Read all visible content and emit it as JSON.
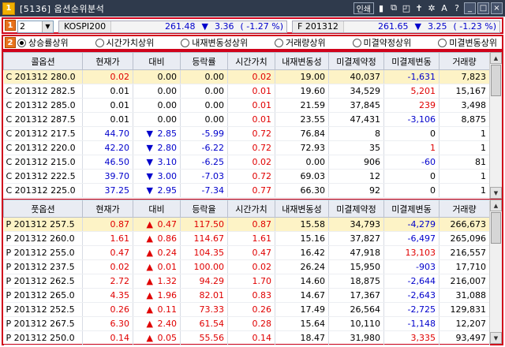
{
  "window": {
    "icon_label": "1",
    "title": "[5136] 옵션순위분석",
    "buttons": [
      "인쇄"
    ],
    "icons": [
      "pin-icon",
      "copy-icon",
      "window-icon",
      "pushpin-icon",
      "settings-icon",
      "font-icon",
      "help-icon",
      "minimize-icon",
      "maximize-icon",
      "close-icon"
    ],
    "icon_glyphs": [
      "▮",
      "⧉",
      "◰",
      "✝",
      "✲",
      "A",
      "?",
      "_",
      "□",
      "×"
    ]
  },
  "markers": [
    "1",
    "2"
  ],
  "controls": {
    "count_select": "2",
    "kospi": {
      "name": "KOSPI200",
      "value": "261.48",
      "direction": "▼",
      "diff": "3.36",
      "pct": "-1.27 %"
    },
    "future": {
      "name": "F 201312",
      "value": "261.65",
      "direction": "▼",
      "diff": "3.25",
      "pct": "-1.23 %"
    }
  },
  "radios": [
    {
      "label": "상승률상위",
      "selected": true
    },
    {
      "label": "시간가치상위",
      "selected": false
    },
    {
      "label": "내재변동성상위",
      "selected": false
    },
    {
      "label": "거래량상위",
      "selected": false
    },
    {
      "label": "미결약정상위",
      "selected": false
    },
    {
      "label": "미결변동상위",
      "selected": false
    }
  ],
  "call_table": {
    "headers": [
      "콜옵션",
      "현재가",
      "대비",
      "등락률",
      "시간가치",
      "내재변동성",
      "미결제약정",
      "미결제변동",
      "거래량"
    ],
    "rows": [
      {
        "code": "C 201312 280.0",
        "price": "0.02",
        "pc": "red",
        "dir": "",
        "diff": "0.00",
        "dc": "black",
        "rate": "0.00",
        "rc": "black",
        "tv": "0.02",
        "iv": "19.00",
        "oi": "40,037",
        "oic": "-1,631",
        "oicc": "blue",
        "vol": "7,823",
        "hl": true
      },
      {
        "code": "C 201312 282.5",
        "price": "0.01",
        "pc": "black",
        "dir": "",
        "diff": "0.00",
        "dc": "black",
        "rate": "0.00",
        "rc": "black",
        "tv": "0.01",
        "iv": "19.60",
        "oi": "34,529",
        "oic": "5,201",
        "oicc": "red",
        "vol": "15,167",
        "hl": false
      },
      {
        "code": "C 201312 285.0",
        "price": "0.01",
        "pc": "black",
        "dir": "",
        "diff": "0.00",
        "dc": "black",
        "rate": "0.00",
        "rc": "black",
        "tv": "0.01",
        "iv": "21.59",
        "oi": "37,845",
        "oic": "239",
        "oicc": "red",
        "vol": "3,498",
        "hl": false
      },
      {
        "code": "C 201312 287.5",
        "price": "0.01",
        "pc": "black",
        "dir": "",
        "diff": "0.00",
        "dc": "black",
        "rate": "0.00",
        "rc": "black",
        "tv": "0.01",
        "iv": "23.55",
        "oi": "47,431",
        "oic": "-3,106",
        "oicc": "blue",
        "vol": "8,875",
        "hl": false
      },
      {
        "code": "C 201312 217.5",
        "price": "44.70",
        "pc": "blue",
        "dir": "▼",
        "diff": "2.85",
        "dc": "blue",
        "rate": "-5.99",
        "rc": "blue",
        "tv": "0.72",
        "iv": "76.84",
        "oi": "8",
        "oic": "0",
        "oicc": "black",
        "vol": "1",
        "hl": false
      },
      {
        "code": "C 201312 220.0",
        "price": "42.20",
        "pc": "blue",
        "dir": "▼",
        "diff": "2.80",
        "dc": "blue",
        "rate": "-6.22",
        "rc": "blue",
        "tv": "0.72",
        "iv": "72.93",
        "oi": "35",
        "oic": "1",
        "oicc": "red",
        "vol": "1",
        "hl": false
      },
      {
        "code": "C 201312 215.0",
        "price": "46.50",
        "pc": "blue",
        "dir": "▼",
        "diff": "3.10",
        "dc": "blue",
        "rate": "-6.25",
        "rc": "blue",
        "tv": "0.02",
        "iv": "0.00",
        "oi": "906",
        "oic": "-60",
        "oicc": "blue",
        "vol": "81",
        "hl": false
      },
      {
        "code": "C 201312 222.5",
        "price": "39.70",
        "pc": "blue",
        "dir": "▼",
        "diff": "3.00",
        "dc": "blue",
        "rate": "-7.03",
        "rc": "blue",
        "tv": "0.72",
        "iv": "69.03",
        "oi": "12",
        "oic": "0",
        "oicc": "black",
        "vol": "1",
        "hl": false
      },
      {
        "code": "C 201312 225.0",
        "price": "37.25",
        "pc": "blue",
        "dir": "▼",
        "diff": "2.95",
        "dc": "blue",
        "rate": "-7.34",
        "rc": "blue",
        "tv": "0.77",
        "iv": "66.30",
        "oi": "92",
        "oic": "0",
        "oicc": "black",
        "vol": "1",
        "hl": false
      }
    ]
  },
  "put_table": {
    "headers": [
      "풋옵션",
      "현재가",
      "대비",
      "등락율",
      "시간가치",
      "내재변동성",
      "미결제약정",
      "미결제변동",
      "거래량"
    ],
    "rows": [
      {
        "code": "P 201312 257.5",
        "price": "0.87",
        "pc": "red",
        "dir": "▲",
        "diff": "0.47",
        "dc": "red",
        "rate": "117.50",
        "rc": "red",
        "tv": "0.87",
        "iv": "15.58",
        "oi": "34,793",
        "oic": "-4,279",
        "oicc": "blue",
        "vol": "266,673",
        "hl": true
      },
      {
        "code": "P 201312 260.0",
        "price": "1.61",
        "pc": "red",
        "dir": "▲",
        "diff": "0.86",
        "dc": "red",
        "rate": "114.67",
        "rc": "red",
        "tv": "1.61",
        "iv": "15.16",
        "oi": "37,827",
        "oic": "-6,497",
        "oicc": "blue",
        "vol": "265,096",
        "hl": false
      },
      {
        "code": "P 201312 255.0",
        "price": "0.47",
        "pc": "red",
        "dir": "▲",
        "diff": "0.24",
        "dc": "red",
        "rate": "104.35",
        "rc": "red",
        "tv": "0.47",
        "iv": "16.42",
        "oi": "47,918",
        "oic": "13,103",
        "oicc": "red",
        "vol": "216,557",
        "hl": false
      },
      {
        "code": "P 201312 237.5",
        "price": "0.02",
        "pc": "red",
        "dir": "▲",
        "diff": "0.01",
        "dc": "red",
        "rate": "100.00",
        "rc": "red",
        "tv": "0.02",
        "iv": "26.24",
        "oi": "15,950",
        "oic": "-903",
        "oicc": "blue",
        "vol": "17,710",
        "hl": false
      },
      {
        "code": "P 201312 262.5",
        "price": "2.72",
        "pc": "red",
        "dir": "▲",
        "diff": "1.32",
        "dc": "red",
        "rate": "94.29",
        "rc": "red",
        "tv": "1.70",
        "iv": "14.60",
        "oi": "18,875",
        "oic": "-2,644",
        "oicc": "blue",
        "vol": "216,007",
        "hl": false
      },
      {
        "code": "P 201312 265.0",
        "price": "4.35",
        "pc": "red",
        "dir": "▲",
        "diff": "1.96",
        "dc": "red",
        "rate": "82.01",
        "rc": "red",
        "tv": "0.83",
        "iv": "14.67",
        "oi": "17,367",
        "oic": "-2,643",
        "oicc": "blue",
        "vol": "31,088",
        "hl": false
      },
      {
        "code": "P 201312 252.5",
        "price": "0.26",
        "pc": "red",
        "dir": "▲",
        "diff": "0.11",
        "dc": "red",
        "rate": "73.33",
        "rc": "red",
        "tv": "0.26",
        "iv": "17.49",
        "oi": "26,564",
        "oic": "-2,725",
        "oicc": "blue",
        "vol": "129,831",
        "hl": false
      },
      {
        "code": "P 201312 267.5",
        "price": "6.30",
        "pc": "red",
        "dir": "▲",
        "diff": "2.40",
        "dc": "red",
        "rate": "61.54",
        "rc": "red",
        "tv": "0.28",
        "iv": "15.64",
        "oi": "10,110",
        "oic": "-1,148",
        "oicc": "blue",
        "vol": "12,207",
        "hl": false
      },
      {
        "code": "P 201312 250.0",
        "price": "0.14",
        "pc": "red",
        "dir": "▲",
        "diff": "0.05",
        "dc": "red",
        "rate": "55.56",
        "rc": "red",
        "tv": "0.14",
        "iv": "18.47",
        "oi": "31,980",
        "oic": "3,335",
        "oicc": "red",
        "vol": "93,497",
        "hl": false
      }
    ]
  }
}
